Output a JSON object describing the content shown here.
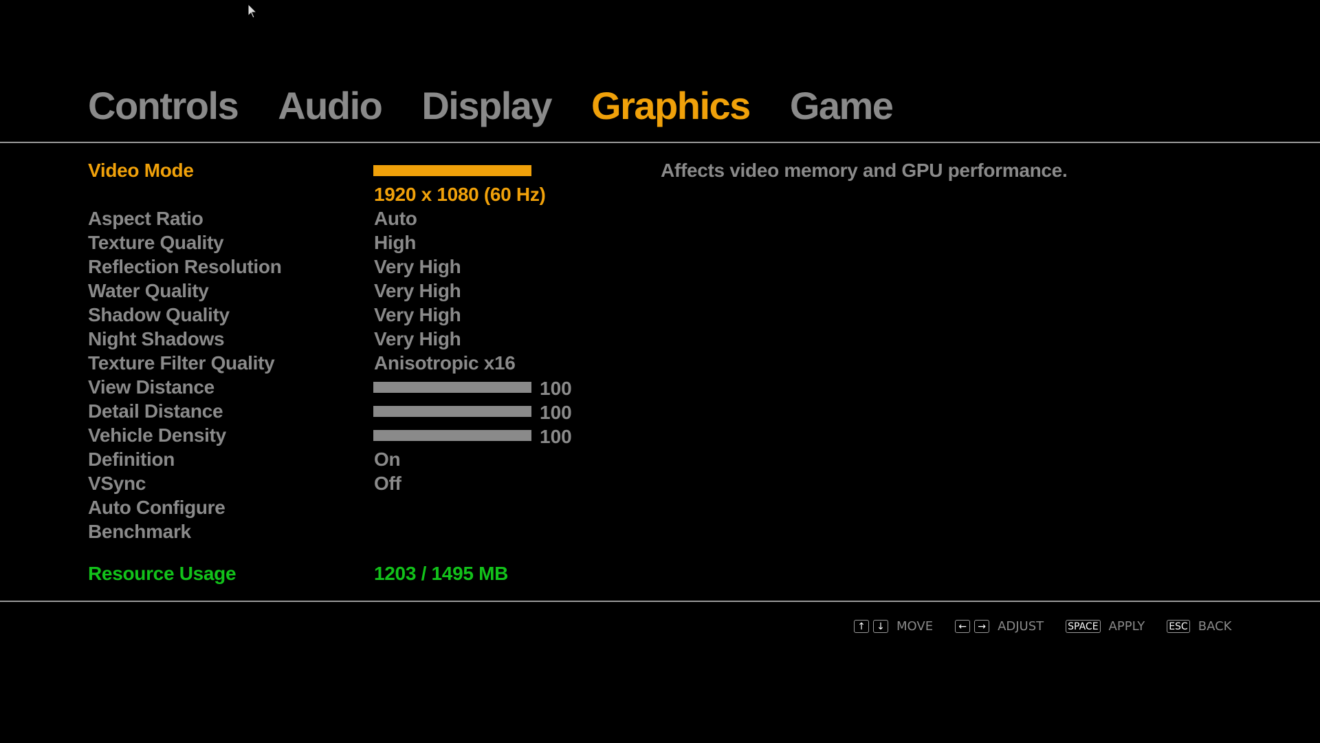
{
  "tabs": [
    {
      "label": "Controls",
      "active": false
    },
    {
      "label": "Audio",
      "active": false
    },
    {
      "label": "Display",
      "active": false
    },
    {
      "label": "Graphics",
      "active": true
    },
    {
      "label": "Game",
      "active": false
    }
  ],
  "settings": {
    "video_mode": {
      "label": "Video Mode",
      "value": "1920 x 1080 (60 Hz)"
    },
    "aspect_ratio": {
      "label": "Aspect Ratio",
      "value": "Auto"
    },
    "texture_quality": {
      "label": "Texture Quality",
      "value": "High"
    },
    "reflection_resolution": {
      "label": "Reflection Resolution",
      "value": "Very High"
    },
    "water_quality": {
      "label": "Water Quality",
      "value": "Very High"
    },
    "shadow_quality": {
      "label": "Shadow Quality",
      "value": "Very High"
    },
    "night_shadows": {
      "label": "Night Shadows",
      "value": "Very High"
    },
    "texture_filter_quality": {
      "label": "Texture Filter Quality",
      "value": "Anisotropic x16"
    },
    "view_distance": {
      "label": "View Distance",
      "value": "100",
      "level_percent": 100
    },
    "detail_distance": {
      "label": "Detail Distance",
      "value": "100",
      "level_percent": 100
    },
    "vehicle_density": {
      "label": "Vehicle Density",
      "value": "100",
      "level_percent": 100
    },
    "definition": {
      "label": "Definition",
      "value": "On"
    },
    "vsync": {
      "label": "VSync",
      "value": "Off"
    },
    "auto_configure": {
      "label": "Auto Configure"
    },
    "benchmark": {
      "label": "Benchmark"
    }
  },
  "resource_usage": {
    "label": "Resource Usage",
    "value": "1203 / 1495 MB"
  },
  "description": "Affects video memory and GPU performance.",
  "footer": {
    "move": {
      "keys": [
        "↑",
        "↓"
      ],
      "label": "MOVE"
    },
    "adjust": {
      "keys": [
        "←",
        "→"
      ],
      "label": "ADJUST"
    },
    "apply": {
      "keys": [
        "SPACE"
      ],
      "label": "APPLY"
    },
    "back": {
      "keys": [
        "ESC"
      ],
      "label": "BACK"
    }
  },
  "colors": {
    "selected": "#f0a10a",
    "normal": "#8a8a8a",
    "resource": "#12c21a",
    "background": "#000000"
  }
}
